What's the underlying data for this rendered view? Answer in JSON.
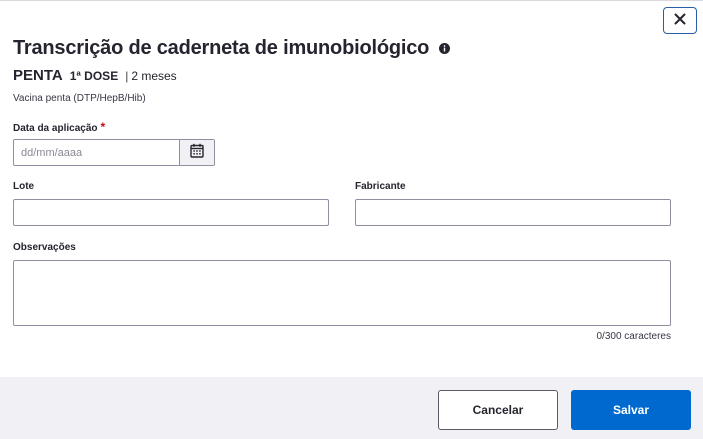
{
  "modal": {
    "title": "Transcrição de caderneta de imunobiológico",
    "vaccine": {
      "sigla": "PENTA",
      "dose": "1ª DOSE",
      "separator": "|",
      "age": "2 meses",
      "description": "Vacina penta (DTP/HepB/Hib)"
    },
    "form": {
      "date_label": "Data da aplicação",
      "required_mark": "*",
      "date_placeholder": "dd/mm/aaaa",
      "lote_label": "Lote",
      "lote_value": "",
      "fabricante_label": "Fabricante",
      "fabricante_value": "",
      "observacoes_label": "Observações",
      "observacoes_value": "",
      "counter": "0/300 caracteres"
    },
    "footer": {
      "cancel_label": "Cancelar",
      "save_label": "Salvar"
    },
    "icons": {
      "close": "close-icon",
      "info": "info-icon",
      "calendar": "calendar-icon"
    },
    "colors": {
      "primary": "#0069d0",
      "required": "#d0021b",
      "close_border": "#2a5ea8",
      "footer_bg": "#f0f0f5"
    }
  }
}
